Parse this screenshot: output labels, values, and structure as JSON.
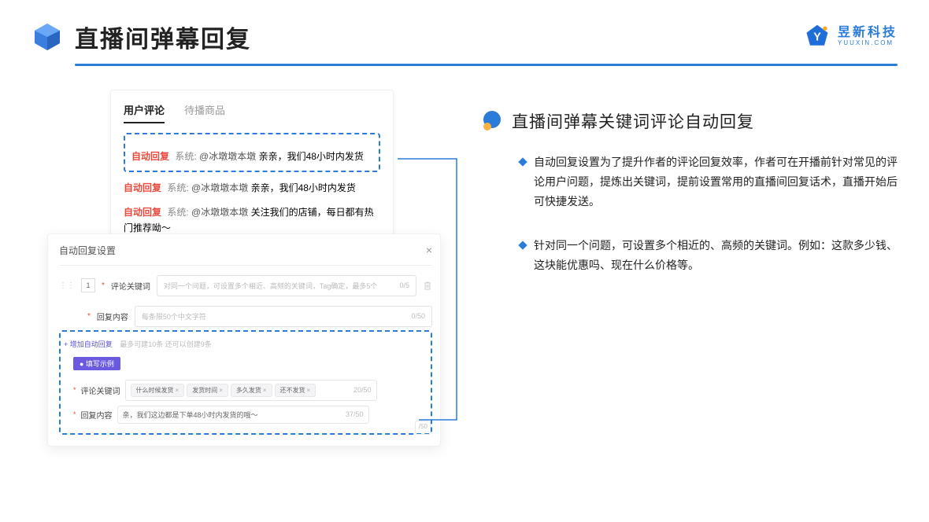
{
  "header": {
    "title": "直播间弹幕回复"
  },
  "brand": {
    "cn": "昱新科技",
    "en": "YUUXIN.COM"
  },
  "panelA": {
    "tab_active": "用户评论",
    "tab_inactive": "待播商品",
    "c1": {
      "tag": "自动回复",
      "sys": "系统:",
      "at": "@冰墩墩本墩",
      "text": " 亲亲，我们48小时内发货"
    },
    "c2": {
      "tag": "自动回复",
      "sys": "系统:",
      "at": "@冰墩墩本墩",
      "text": " 亲亲，我们48小时内发货"
    },
    "c3": {
      "tag": "自动回复",
      "sys": "系统:",
      "at": "@冰墩墩本墩",
      "text": " 关注我们的店铺，每日都有热门推荐呦～"
    }
  },
  "panelB": {
    "title": "自动回复设置",
    "num": "1",
    "kw_label": "评论关键词",
    "kw_placeholder": "对同一个问题，可设置多个相近、高频的关键词，Tag确定，最多5个",
    "kw_count": "0/5",
    "content_label": "回复内容",
    "content_placeholder": "每条限50个中文字符",
    "content_count": "0/50",
    "add_link": "+ 增加自动回复",
    "add_hint": "最多可建10条 还可以创建9条",
    "example_pill": "● 填写示例",
    "ex_kw_label": "评论关键词",
    "tags": [
      "什么时候发货",
      "发货时间",
      "多久发货",
      "还不发货"
    ],
    "ex_kw_count": "20/50",
    "ex_content_label": "回复内容",
    "ex_content_value": "亲，我们这边都是下单48小时内发货的哦～",
    "ex_content_count": "37/50",
    "spare_count": "/50"
  },
  "right": {
    "heading": "直播间弹幕关键词评论自动回复",
    "b1": "自动回复设置为了提升作者的评论回复效率，作者可在开播前针对常见的评论用户问题，提炼出关键词，提前设置常用的直播间回复话术，直播开始后可快捷发送。",
    "b2": "针对同一个问题，可设置多个相近的、高频的关键词。例如：这款多少钱、这块能优惠吗、现在什么价格等。"
  }
}
